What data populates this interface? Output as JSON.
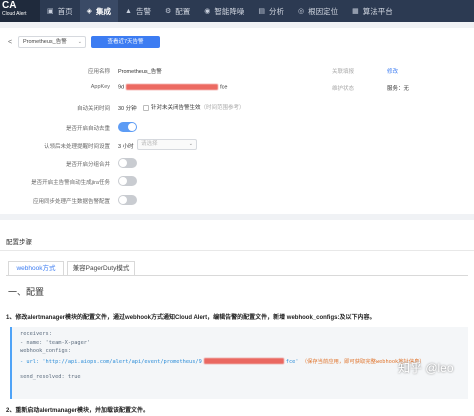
{
  "brand": {
    "title": "CA",
    "subtitle": "Cloud Alert"
  },
  "nav": [
    {
      "icon": "▣",
      "label": "首页",
      "name": "home",
      "active": false
    },
    {
      "icon": "◈",
      "label": "集成",
      "name": "integration",
      "active": true
    },
    {
      "icon": "▲",
      "label": "告警",
      "name": "alarm",
      "active": false
    },
    {
      "icon": "⚙",
      "label": "配置",
      "name": "config",
      "active": false
    },
    {
      "icon": "◉",
      "label": "智能降噪",
      "name": "noise-reduction",
      "active": false
    },
    {
      "icon": "▤",
      "label": "分析",
      "name": "analysis",
      "active": false
    },
    {
      "icon": "◎",
      "label": "根因定位",
      "name": "root-cause",
      "active": false
    },
    {
      "icon": "▦",
      "label": "算法平台",
      "name": "algorithm",
      "active": false
    }
  ],
  "toolbar": {
    "back": "<",
    "app_select": "Prometheus_告警",
    "caret": "⌄",
    "button": "查看近7天告警"
  },
  "form": {
    "app_name_label": "应用名称",
    "app_name": "Prometheus_告警",
    "appkey_label": "AppKey",
    "appkey_prefix": "9d",
    "appkey_suffix": "fce",
    "related_label": "关联填报",
    "related_link": "修改",
    "maintain_label": "维护状态",
    "maintain_value": "服务：无",
    "auto_close_label": "自动关闭时间",
    "auto_close_value": "30 分钟",
    "auto_close_check": "针对未关闭告警生效",
    "auto_close_hint": "（时间范围参考）",
    "dedupe_label": "是否开启自动去重",
    "ack_label": "认领后未处理提醒时间设置",
    "ack_value": "3 小时",
    "ack_placeholder": "请选择",
    "group_label": "是否开启分组合并",
    "jira_label": "是否开启主告警自动生成jira任务",
    "priority_label": "应用同步处理产生数据告警配置"
  },
  "steps": {
    "title": "配置步骤",
    "tabs": [
      "webhook方式",
      "兼容PagerDuty模式"
    ],
    "heading": "一、配置",
    "step1": "1、修改alertmanager模块的配置文件，通过webhook方式通知Cloud Alert，编辑告警的配置文件，新增 webhook_configs:及以下内容。",
    "step2": "2、重新启动alertmanager模块，并加载该配置文件。",
    "code": {
      "l1": "receivers:",
      "l2": "- name: 'team-X-pager'",
      "l3": "webhook_configs:",
      "l4_prefix": "- url: 'http://api.aiops.com/alert/api/event/prometheus/9",
      "l4_suffix": "fce'",
      "l4_comment": "（保存当前应用，即可获取完整webhook地址信息）",
      "l5": "send_resolved: true"
    }
  },
  "watermark": "知乎 @leo",
  "toggles": {
    "dedupe": true,
    "group": false,
    "jira": false,
    "priority": false
  },
  "colors": {
    "nav_bg": "#2c3a52",
    "primary": "#3c7cf2",
    "toggle_on": "#5d9cf5",
    "redact": "#e8453c"
  }
}
